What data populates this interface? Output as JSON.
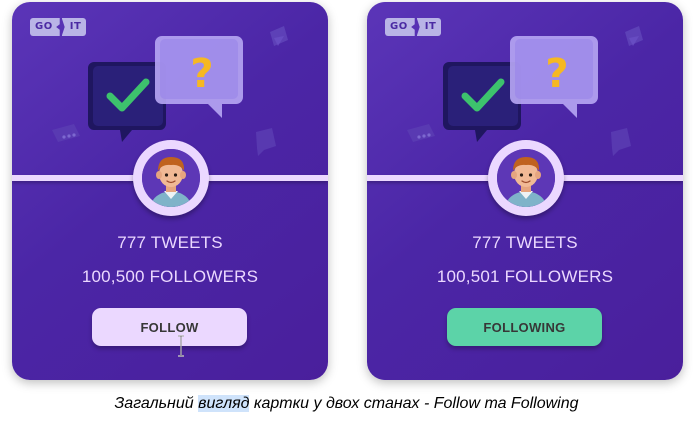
{
  "logo": {
    "go": "GO",
    "it": "IT"
  },
  "cards": [
    {
      "tweets_text": "777 TWEETS",
      "followers_text": "100,500 FOLLOWERS",
      "button_label": "FOLLOW",
      "button_color": "#ebd8ff"
    },
    {
      "tweets_text": "777 TWEETS",
      "followers_text": "100,501 FOLLOWERS",
      "button_label": "FOLLOWING",
      "button_color": "#5cd3a8"
    }
  ],
  "caption": {
    "before": "Загальний ",
    "highlight": "вигляд",
    "after": " картки у двох станах - Follow та Following"
  },
  "icons": {
    "illustration": "question-check-bubbles-icon",
    "avatar": "boy-avatar-icon",
    "cursor": "text-cursor-icon"
  },
  "colors": {
    "card_bg": "#4b26a6",
    "accent": "#ebd8ff",
    "following": "#5cd3a8",
    "text": "#ebd8ff"
  }
}
